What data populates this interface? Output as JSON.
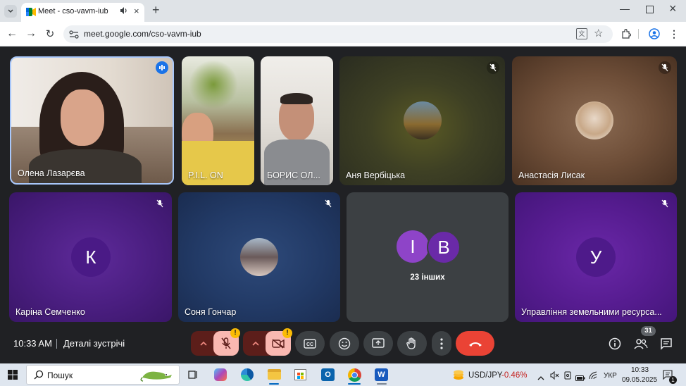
{
  "browser": {
    "tab_title": "Meet - cso-vavm-iub",
    "url": "meet.google.com/cso-vavm-iub"
  },
  "tiles": {
    "olena": "Олена Лазарєва",
    "pil": "P.I.L. ON",
    "borys": "БОРИС ОЛ...",
    "anya": "Аня Вербіцька",
    "anastasia": "Анастасія Лисак",
    "karina": "Каріна Семченко",
    "karina_initial": "К",
    "sonya": "Соня Гончар",
    "others_label": "23 інших",
    "others_initial_1": "I",
    "others_initial_2": "B",
    "upravlinnia": "Управління земельними ресурса...",
    "upravlinnia_initial": "У"
  },
  "bottom_bar": {
    "time": "10:33 AM",
    "details": "Деталі зустрічі",
    "people_count": "31",
    "alert_1": "!",
    "alert_2": "!"
  },
  "taskbar": {
    "search_placeholder": "Пошук",
    "ticker": "USD/JPY",
    "ticker_change": "-0.46%",
    "lang": "УКР",
    "time": "10:33",
    "date": "09.05.2025",
    "notif_count": "1"
  },
  "colors": {
    "end_call": "#ea4335",
    "muted_control": "#f9b8b1",
    "active_speaker_border": "#a8c7fa",
    "tile_purple": "#5b1f8a",
    "tile_blue": "#1e3a6e",
    "ticker_negative": "#c5221f"
  }
}
